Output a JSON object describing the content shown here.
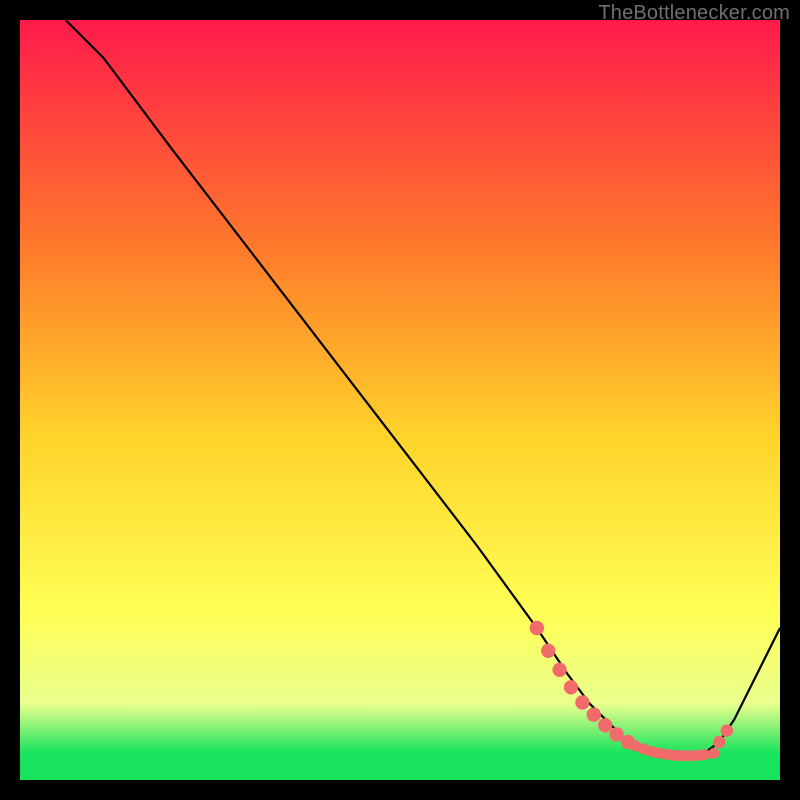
{
  "attribution": "TheBottlenecker.com",
  "colors": {
    "bg_black": "#000000",
    "grad_top": "#ff1a4b",
    "grad_mid_upper": "#ff7a2b",
    "grad_mid": "#ffd42a",
    "grad_mid_lower": "#ffff55",
    "grad_lower": "#e9ff8e",
    "grad_green": "#17e35c",
    "line_black": "#000000",
    "marker_fill": "#f26b6b",
    "marker_stroke": "#e85a5a"
  },
  "chart_data": {
    "type": "line",
    "title": "",
    "xlabel": "",
    "ylabel": "",
    "xlim": [
      0,
      100
    ],
    "ylim": [
      0,
      100
    ],
    "series": [
      {
        "name": "curve",
        "x": [
          6,
          11,
          20,
          30,
          40,
          50,
          60,
          68,
          72,
          75,
          78,
          80,
          82,
          84,
          86,
          88,
          90,
          92,
          94,
          100
        ],
        "y": [
          100,
          95,
          83,
          70,
          57,
          44,
          31,
          20,
          14,
          10,
          7,
          5,
          4,
          3.5,
          3.2,
          3.2,
          3.5,
          5,
          8,
          20
        ]
      }
    ],
    "markers": {
      "name": "highlight",
      "points": [
        {
          "x": 68,
          "y": 20,
          "r": 3
        },
        {
          "x": 69.5,
          "y": 17,
          "r": 3
        },
        {
          "x": 71,
          "y": 14.5,
          "r": 3
        },
        {
          "x": 72.5,
          "y": 12.2,
          "r": 3
        },
        {
          "x": 74,
          "y": 10.2,
          "r": 3
        },
        {
          "x": 75.5,
          "y": 8.6,
          "r": 3
        },
        {
          "x": 77,
          "y": 7.2,
          "r": 3
        },
        {
          "x": 78.5,
          "y": 6,
          "r": 3
        },
        {
          "x": 80,
          "y": 5,
          "r": 3
        },
        {
          "x": 81,
          "y": 4.5,
          "r": 2.3
        },
        {
          "x": 82,
          "y": 4.1,
          "r": 2.3
        },
        {
          "x": 82.9,
          "y": 3.8,
          "r": 2.3
        },
        {
          "x": 83.7,
          "y": 3.6,
          "r": 2.3
        },
        {
          "x": 84.5,
          "y": 3.45,
          "r": 2.3
        },
        {
          "x": 85.3,
          "y": 3.35,
          "r": 2.3
        },
        {
          "x": 86.1,
          "y": 3.25,
          "r": 2.3
        },
        {
          "x": 86.9,
          "y": 3.2,
          "r": 2.3
        },
        {
          "x": 87.7,
          "y": 3.2,
          "r": 2.3
        },
        {
          "x": 88.5,
          "y": 3.2,
          "r": 2.3
        },
        {
          "x": 89.3,
          "y": 3.25,
          "r": 2.3
        },
        {
          "x": 90.1,
          "y": 3.35,
          "r": 2.3
        },
        {
          "x": 91.3,
          "y": 3.5,
          "r": 2.3
        },
        {
          "x": 92,
          "y": 5,
          "r": 2.6
        },
        {
          "x": 93,
          "y": 6.5,
          "r": 2.6
        }
      ]
    },
    "gradient_stops": [
      {
        "offset": 0.0,
        "key": "grad_top"
      },
      {
        "offset": 0.3,
        "key": "grad_mid_upper"
      },
      {
        "offset": 0.55,
        "key": "grad_mid"
      },
      {
        "offset": 0.78,
        "key": "grad_mid_lower"
      },
      {
        "offset": 0.9,
        "key": "grad_lower"
      },
      {
        "offset": 0.965,
        "key": "grad_green"
      },
      {
        "offset": 1.0,
        "key": "grad_green"
      }
    ]
  }
}
